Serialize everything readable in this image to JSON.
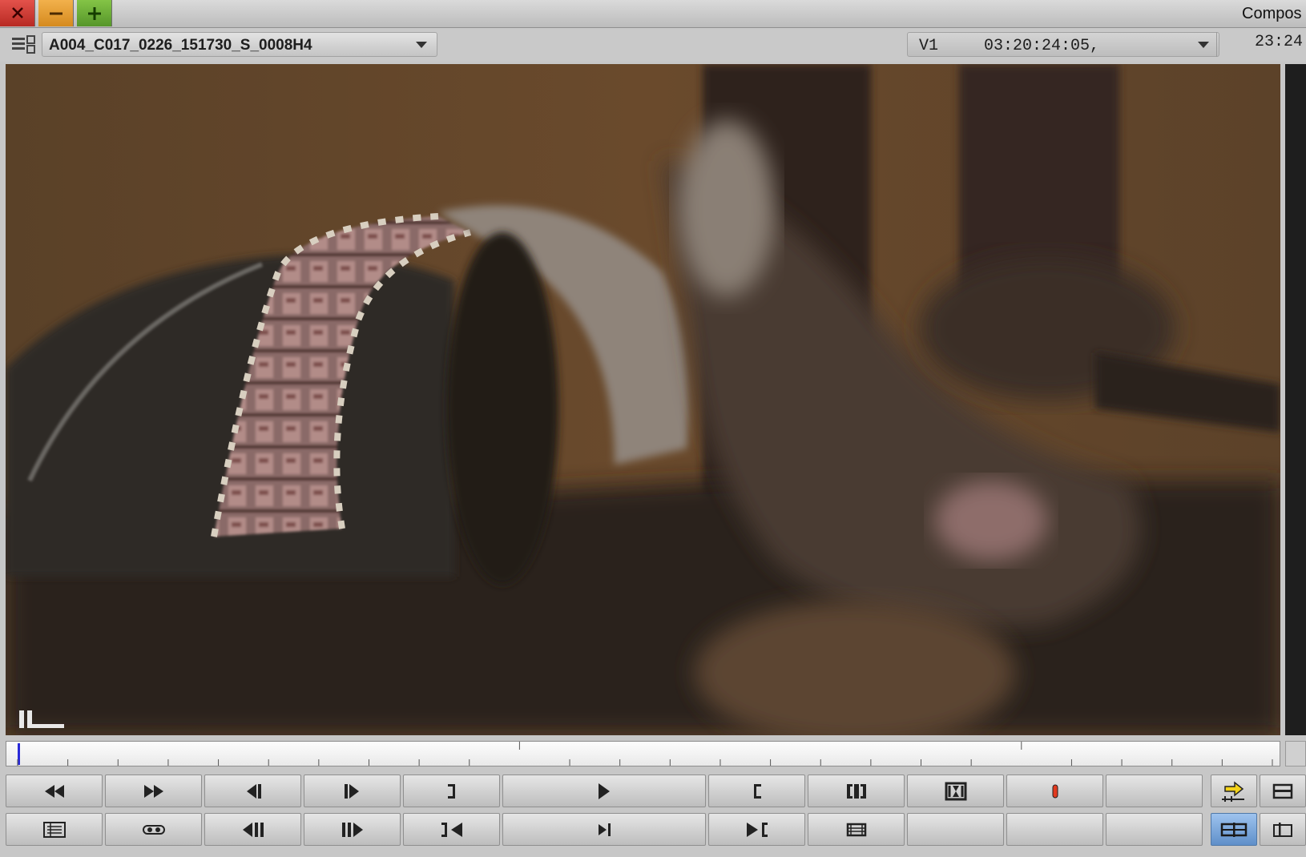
{
  "window": {
    "title": "Compos",
    "controls": [
      "close-icon",
      "minimize-icon",
      "maximize-icon"
    ],
    "control_colors": {
      "close": "#d6403a",
      "minimize": "#e8a03a",
      "maximize": "#6aae36"
    }
  },
  "source": {
    "clip_name": "A004_C017_0226_151730_S_0008H4",
    "track": "V1",
    "timecode": "03:20:24:05,",
    "timecode_right": "23:24"
  },
  "transport": {
    "row1": [
      "rewind-icon",
      "fast-forward-icon",
      "step-backward-icon",
      "step-forward-icon",
      "mark-out-icon",
      "play-icon",
      "mark-in-icon",
      "mark-clip-icon",
      "clear-marks-icon",
      "add-marker-icon",
      "empty",
      "source-record-toggle-icon",
      "single-monitor-icon"
    ],
    "row2": [
      "clip-list-icon",
      "tape-icon",
      "go-to-previous-edit-icon",
      "go-to-next-edit-icon",
      "go-to-in-icon",
      "play-in-to-out-icon",
      "go-to-out-icon",
      "match-frame-icon",
      "empty",
      "empty",
      "empty",
      "dual-monitor-icon",
      "split-view-icon"
    ]
  },
  "colors": {
    "accent": "#2a2ad8",
    "record": "#e23a1f",
    "active_button": "#7aa6dd"
  }
}
